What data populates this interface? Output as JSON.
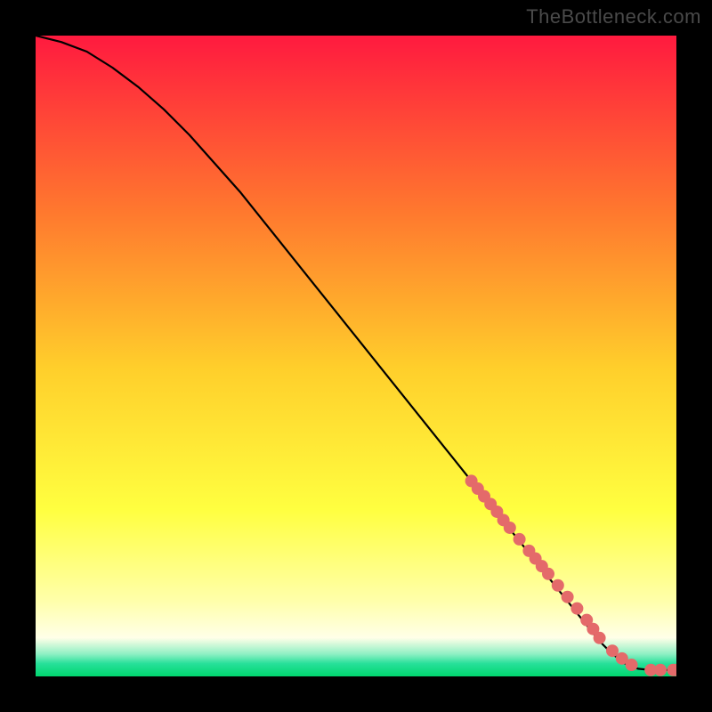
{
  "watermark": "TheBottleneck.com",
  "colors": {
    "gradient_top": "#ff1a3f",
    "gradient_mid1": "#ff7a2e",
    "gradient_mid2": "#ffcf2b",
    "gradient_yellow": "#ffff40",
    "gradient_paleyellow": "#ffffa8",
    "gradient_teal": "#27e09a",
    "gradient_green": "#00d66e",
    "curve": "#000000",
    "marker": "#e46a6a",
    "frame": "#000000"
  },
  "chart_data": {
    "type": "line",
    "title": "",
    "xlabel": "",
    "ylabel": "",
    "xlim": [
      0,
      100
    ],
    "ylim": [
      0,
      100
    ],
    "series": [
      {
        "name": "bottleneck-curve",
        "x": [
          0,
          4,
          8,
          12,
          16,
          20,
          24,
          28,
          32,
          36,
          40,
          44,
          48,
          52,
          56,
          60,
          64,
          68,
          72,
          76,
          80,
          84,
          86,
          88,
          90,
          92,
          94,
          96,
          98,
          100
        ],
        "y": [
          100,
          99,
          97.5,
          95,
          92,
          88.5,
          84.5,
          80,
          75.5,
          70.5,
          65.5,
          60.5,
          55.5,
          50.5,
          45.5,
          40.5,
          35.5,
          30.5,
          25.5,
          20.5,
          15.5,
          10.5,
          8,
          5.5,
          3.5,
          2,
          1.2,
          1,
          1,
          1
        ]
      }
    ],
    "markers": {
      "name": "highlighted-points",
      "x": [
        68,
        69,
        70,
        71,
        72,
        73,
        74,
        75.5,
        77,
        78,
        79,
        80,
        81.5,
        83,
        84.5,
        86,
        87,
        88,
        90,
        91.5,
        93,
        96,
        97.5,
        99.5,
        100
      ],
      "y": [
        30.5,
        29.3,
        28.1,
        26.9,
        25.7,
        24.4,
        23.2,
        21.4,
        19.6,
        18.4,
        17.2,
        16,
        14.2,
        12.4,
        10.6,
        8.8,
        7.4,
        6,
        4,
        2.8,
        1.8,
        1,
        1,
        1,
        1
      ]
    }
  }
}
